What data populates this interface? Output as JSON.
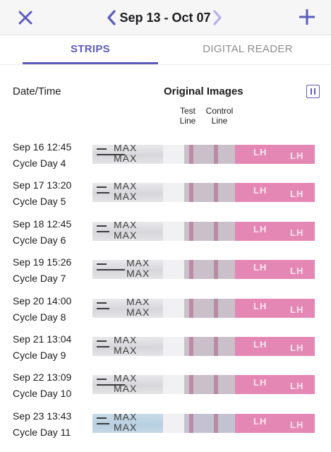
{
  "nav": {
    "title": "Sep 13 - Oct 07"
  },
  "tabs": [
    {
      "label": "STRIPS",
      "active": true
    },
    {
      "label": "DIGITAL READER",
      "active": false
    }
  ],
  "columns": {
    "date": "Date/Time",
    "images": "Original Images",
    "test": "Test\nLine",
    "control": "Control\nLine"
  },
  "strip_text": {
    "max": "MAX",
    "lh": "LH"
  },
  "rows": [
    {
      "date": "Sep 16 12:45",
      "cycle": "Cycle Day 4"
    },
    {
      "date": "Sep 17 13:20",
      "cycle": "Cycle Day 5"
    },
    {
      "date": "Sep 18 12:45",
      "cycle": "Cycle Day 6"
    },
    {
      "date": "Sep 19 15:26",
      "cycle": "Cycle Day 7"
    },
    {
      "date": "Sep 20 14:00",
      "cycle": "Cycle Day 8"
    },
    {
      "date": "Sep 21 13:04",
      "cycle": "Cycle Day 9"
    },
    {
      "date": "Sep 22 13:09",
      "cycle": "Cycle Day 10"
    },
    {
      "date": "Sep 23 13:43",
      "cycle": "Cycle Day 11"
    }
  ],
  "colors": {
    "accent": "#5b5bbd",
    "inactive_tab": "#8e8e93",
    "strip_pink": "#e487b4"
  },
  "icons": {
    "close": "close-icon",
    "prev": "chevron-left-icon",
    "next": "chevron-right-icon",
    "add": "plus-icon",
    "pause": "pause-icon"
  }
}
